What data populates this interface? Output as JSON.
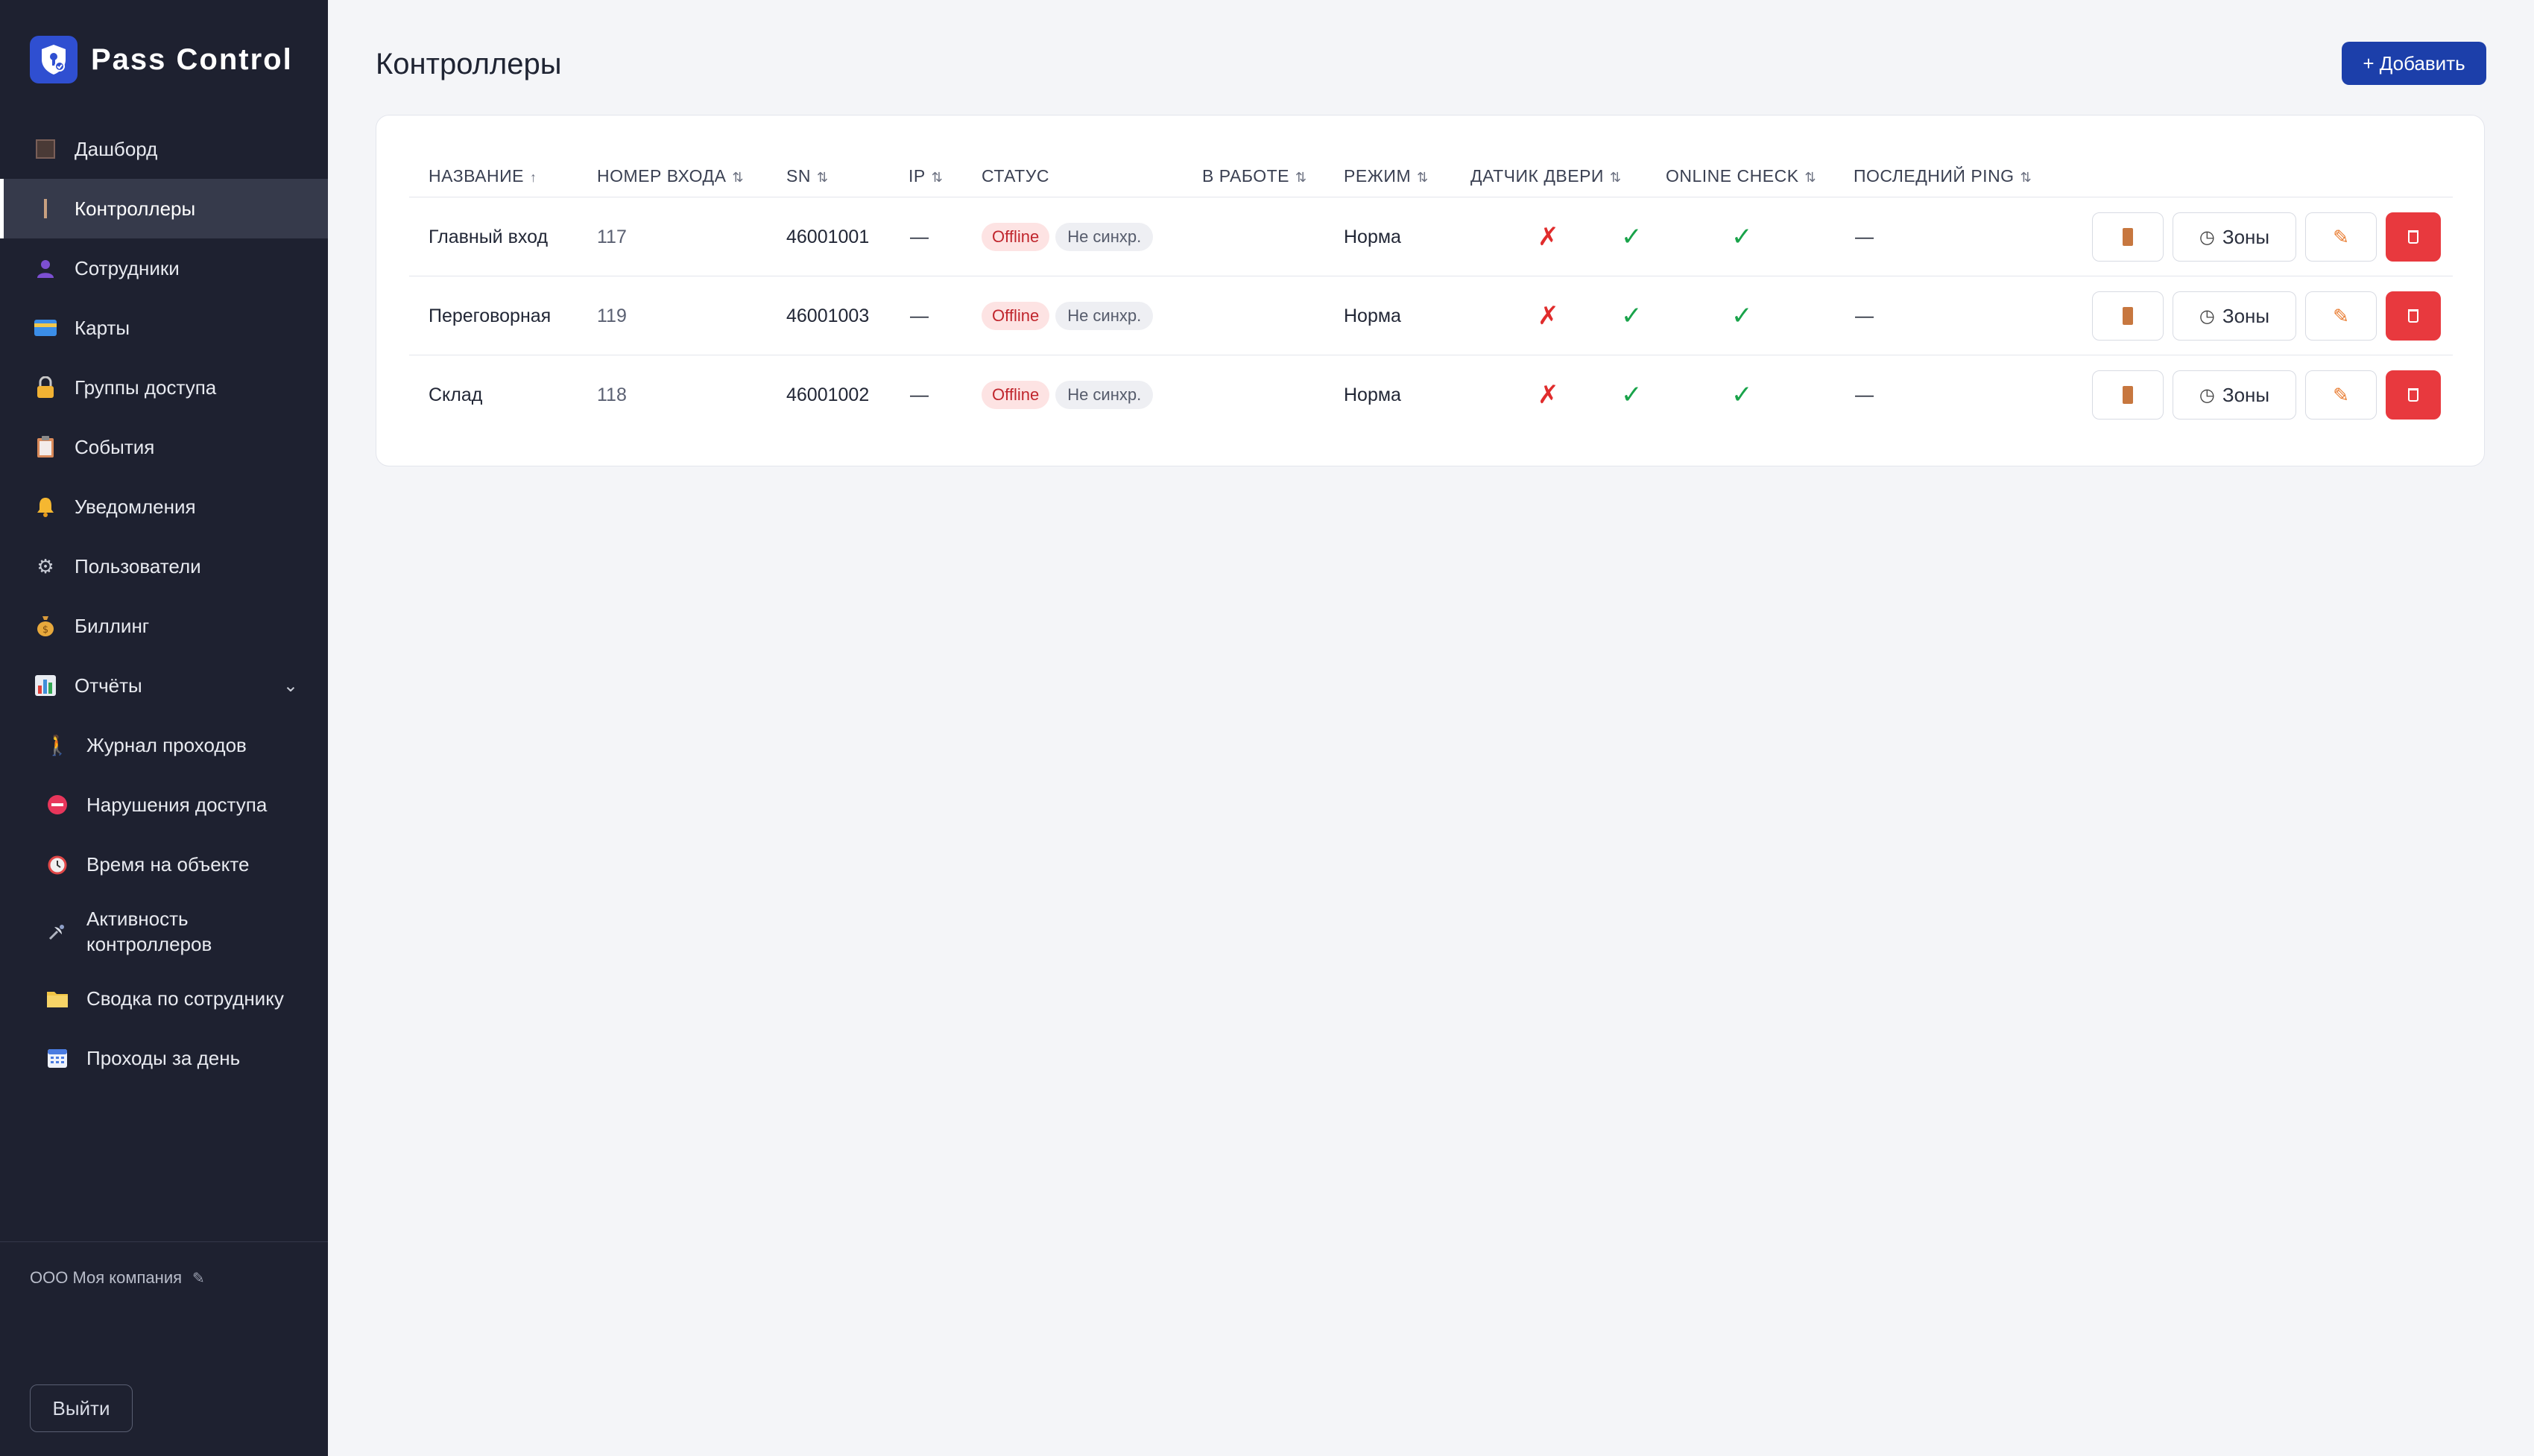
{
  "app": {
    "name": "Pass Control",
    "colors": {
      "sidebar": "#1e2130",
      "primary": "#1c3faa",
      "danger": "#e8393e",
      "success": "#19a34a"
    }
  },
  "sidebar": {
    "items": [
      {
        "label": "Дашборд",
        "icon": "dashboard-icon"
      },
      {
        "label": "Контроллеры",
        "icon": "controller-icon",
        "active": true
      },
      {
        "label": "Сотрудники",
        "icon": "person-icon"
      },
      {
        "label": "Карты",
        "icon": "credit-card-icon"
      },
      {
        "label": "Группы доступа",
        "icon": "lock-icon"
      },
      {
        "label": "События",
        "icon": "clipboard-icon"
      },
      {
        "label": "Уведомления",
        "icon": "bell-icon"
      },
      {
        "label": "Пользователи",
        "icon": "gear-icon"
      },
      {
        "label": "Биллинг",
        "icon": "money-bag-icon"
      },
      {
        "label": "Отчёты",
        "icon": "bar-chart-icon",
        "expanded": true
      }
    ],
    "reports": [
      {
        "label": "Журнал проходов",
        "icon": "walking-icon"
      },
      {
        "label": "Нарушения доступа",
        "icon": "no-entry-icon"
      },
      {
        "label": "Время на объекте",
        "icon": "alarm-clock-icon"
      },
      {
        "label": "Активность контроллеров",
        "icon": "satellite-icon"
      },
      {
        "label": "Сводка по сотруднику",
        "icon": "folder-icon"
      },
      {
        "label": "Проходы за день",
        "icon": "calendar-icon"
      }
    ],
    "company": "ООО Моя компания",
    "logout": "Выйти"
  },
  "page": {
    "title": "Контроллеры",
    "add_button": "+ Добавить"
  },
  "table": {
    "columns": [
      "НАЗВАНИЕ",
      "НОМЕР ВХОДА",
      "SN",
      "IP",
      "СТАТУС",
      "В РАБОТЕ",
      "РЕЖИМ",
      "ДАТЧИК ДВЕРИ",
      "ONLINE CHECK",
      "ПОСЛЕДНИЙ PING"
    ],
    "sort_asc": "↑",
    "sort_both": "⇅",
    "check": "✓",
    "cross": "✗",
    "zones_label": "Зоны",
    "rows": [
      {
        "name": "Главный вход",
        "entry": "117",
        "sn": "46001001",
        "ip": "—",
        "status": "Offline",
        "sync": "Не синхр.",
        "mode": "Норма",
        "ping": "—"
      },
      {
        "name": "Переговорная",
        "entry": "119",
        "sn": "46001003",
        "ip": "—",
        "status": "Offline",
        "sync": "Не синхр.",
        "mode": "Норма",
        "ping": "—"
      },
      {
        "name": "Склад",
        "entry": "118",
        "sn": "46001002",
        "ip": "—",
        "status": "Offline",
        "sync": "Не синхр.",
        "mode": "Норма",
        "ping": "—"
      }
    ]
  }
}
